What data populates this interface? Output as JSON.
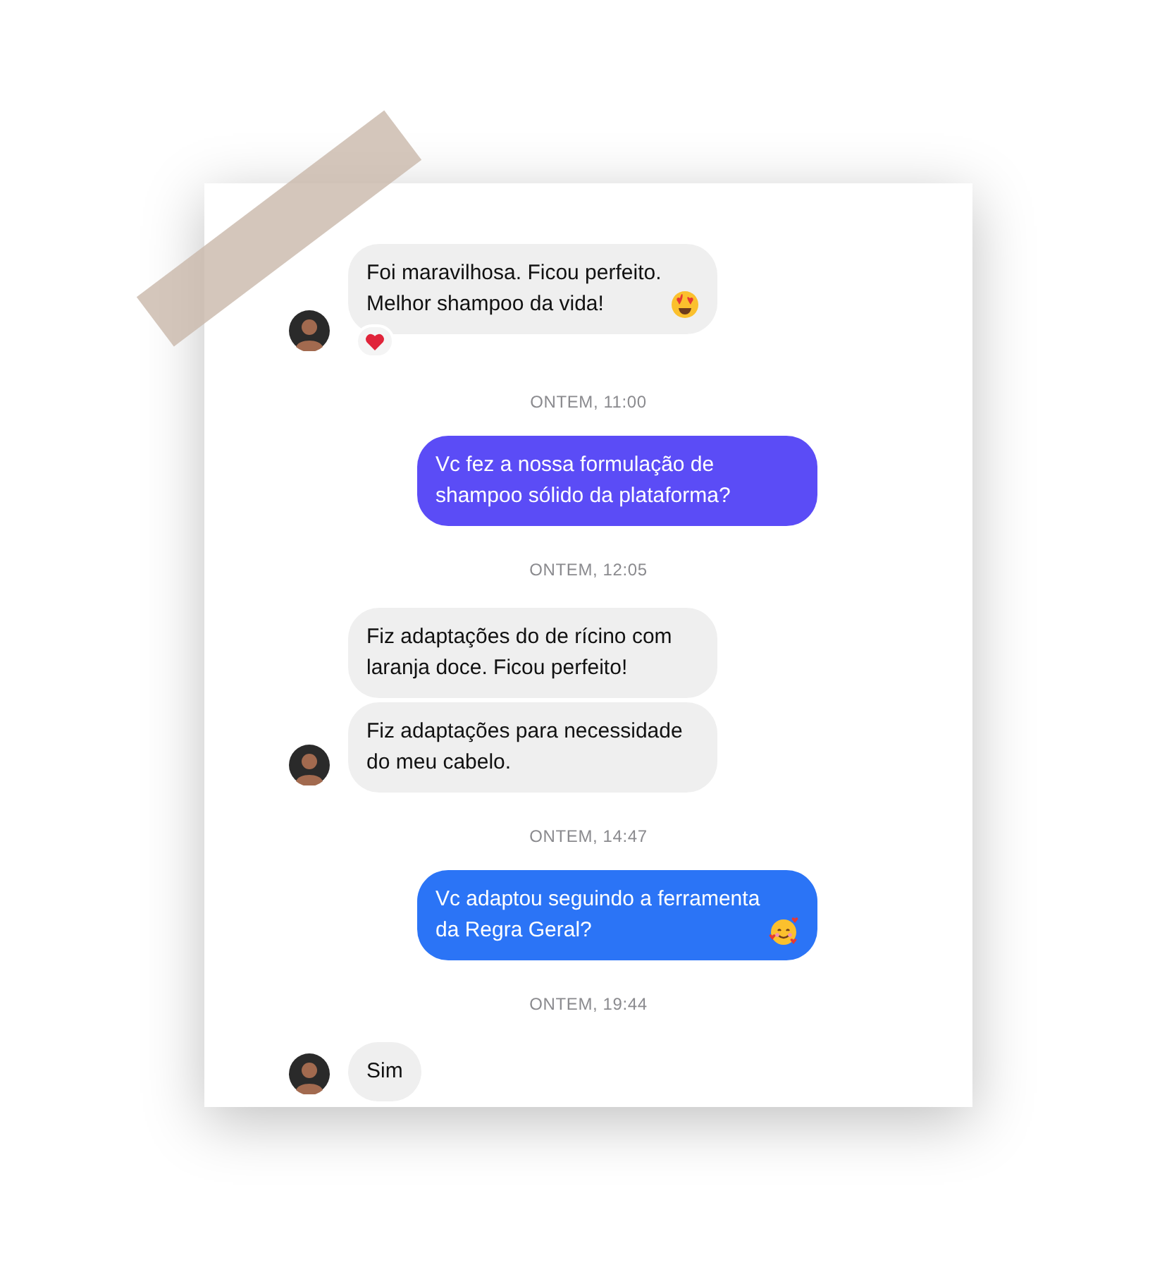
{
  "messages": [
    {
      "kind": "received",
      "text": "Foi maravilhosa. Ficou perfeito. Melhor shampoo da vida!",
      "heart_eyes_emoji": true,
      "heart_reaction": true,
      "avatar": true
    },
    {
      "kind": "timestamp",
      "text": "ONTEM, 11:00"
    },
    {
      "kind": "sent",
      "text": "Vc fez a nossa formulação de shampoo sólido da plataforma?",
      "color": "#5b4cf6"
    },
    {
      "kind": "timestamp",
      "text": "ONTEM, 12:05"
    },
    {
      "kind": "received",
      "text": "Fiz adaptações do de rícino com laranja doce. Ficou perfeito!",
      "avatar": false
    },
    {
      "kind": "received",
      "text": "Fiz adaptações para necessidade do meu cabelo.",
      "avatar": true
    },
    {
      "kind": "timestamp",
      "text": "ONTEM, 14:47"
    },
    {
      "kind": "sent",
      "text": "Vc adaptou seguindo a ferramenta da Regra Geral?",
      "smiling_hearts_emoji": true,
      "color": "#2b74f6"
    },
    {
      "kind": "timestamp",
      "text": "ONTEM, 19:44"
    },
    {
      "kind": "received",
      "text": "Sim",
      "avatar": true
    }
  ]
}
